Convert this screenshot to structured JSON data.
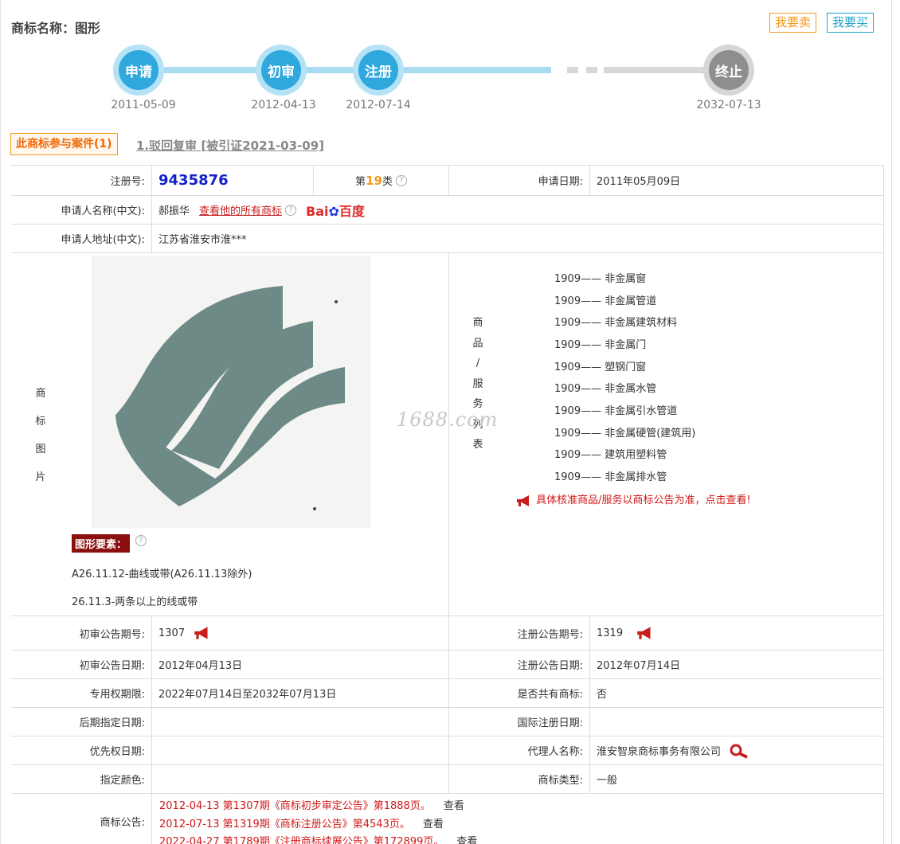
{
  "header": {
    "title": "商标名称：图形",
    "sell_label": "我要卖",
    "buy_label": "我要买"
  },
  "timeline": {
    "steps": [
      {
        "label": "申请",
        "date": "2011-05-09"
      },
      {
        "label": "初审",
        "date": "2012-04-13"
      },
      {
        "label": "注册",
        "date": "2012-07-14"
      },
      {
        "label": "终止",
        "date": "2032-07-13"
      }
    ]
  },
  "cases": {
    "tag": "此商标参与案件(1)",
    "link": "1.驳回复审 [被引证2021-03-09]"
  },
  "info": {
    "reg_no_label": "注册号:",
    "reg_no": "9435876",
    "class_prefix": "第",
    "class_num": "19",
    "class_suffix": "类",
    "apply_date_label": "申请日期:",
    "apply_date": "2011年05月09日",
    "applicant_label": "申请人名称(中文):",
    "applicant": "郝振华",
    "view_all_label": "查看他的所有商标",
    "baidu_a": "Bai",
    "baidu_b": "百度",
    "address_label": "申请人地址(中文):",
    "address": "江苏省淮安市淮***",
    "image_label_chars": [
      "商",
      "标",
      "图",
      "片"
    ],
    "goods_label_chars": [
      "商",
      "品",
      "/",
      "服",
      "务",
      "列",
      "表"
    ],
    "goods": [
      "1909—— 非金属窗",
      "1909—— 非金属管道",
      "1909—— 非金属建筑材料",
      "1909—— 非金属门",
      "1909—— 塑钢门窗",
      "1909—— 非金属水管",
      "1909—— 非金属引水管道",
      "1909—— 非金属硬管(建筑用)",
      "1909—— 建筑用塑料管",
      "1909—— 非金属排水管"
    ],
    "goods_notice": "具体核准商品/服务以商标公告为准，点击查看!",
    "watermark": "1688.com",
    "elements_tag": "图形要素：",
    "elements": [
      "A26.11.12-曲线或带(A26.11.13除外)",
      "26.11.3-两条以上的线或带"
    ],
    "prelim_no_label": "初审公告期号:",
    "prelim_no": "1307",
    "reg_pub_no_label": "注册公告期号:",
    "reg_pub_no": "1319",
    "prelim_date_label": "初审公告日期:",
    "prelim_date": "2012年04月13日",
    "reg_pub_date_label": "注册公告日期:",
    "reg_pub_date": "2012年07月14日",
    "exclusive_label": "专用权期限:",
    "exclusive": "2022年07月14日至2032年07月13日",
    "shared_label": "是否共有商标:",
    "shared": "否",
    "later_label": "后期指定日期:",
    "later": "",
    "intl_label": "国际注册日期:",
    "intl": "",
    "priority_label": "优先权日期:",
    "priority": "",
    "agent_label": "代理人名称:",
    "agent": "淮安智泉商标事务有限公司",
    "color_label": "指定颜色:",
    "color": "",
    "type_label": "商标类型:",
    "type": "一般",
    "announce_label": "商标公告:",
    "announcements": [
      {
        "text": "2012-04-13 第1307期《商标初步审定公告》第1888页。",
        "view": "查看"
      },
      {
        "text": "2012-07-13 第1319期《商标注册公告》第4543页。",
        "view": "查看"
      },
      {
        "text": "2022-04-27 第1789期《注册商标续展公告》第172899页。",
        "view": "查看"
      }
    ]
  },
  "colors": {
    "accent_orange": "#f09a1a",
    "accent_blue": "#2fa9dd",
    "reg_no_blue": "#1322c8",
    "notice_red": "#d01818"
  }
}
